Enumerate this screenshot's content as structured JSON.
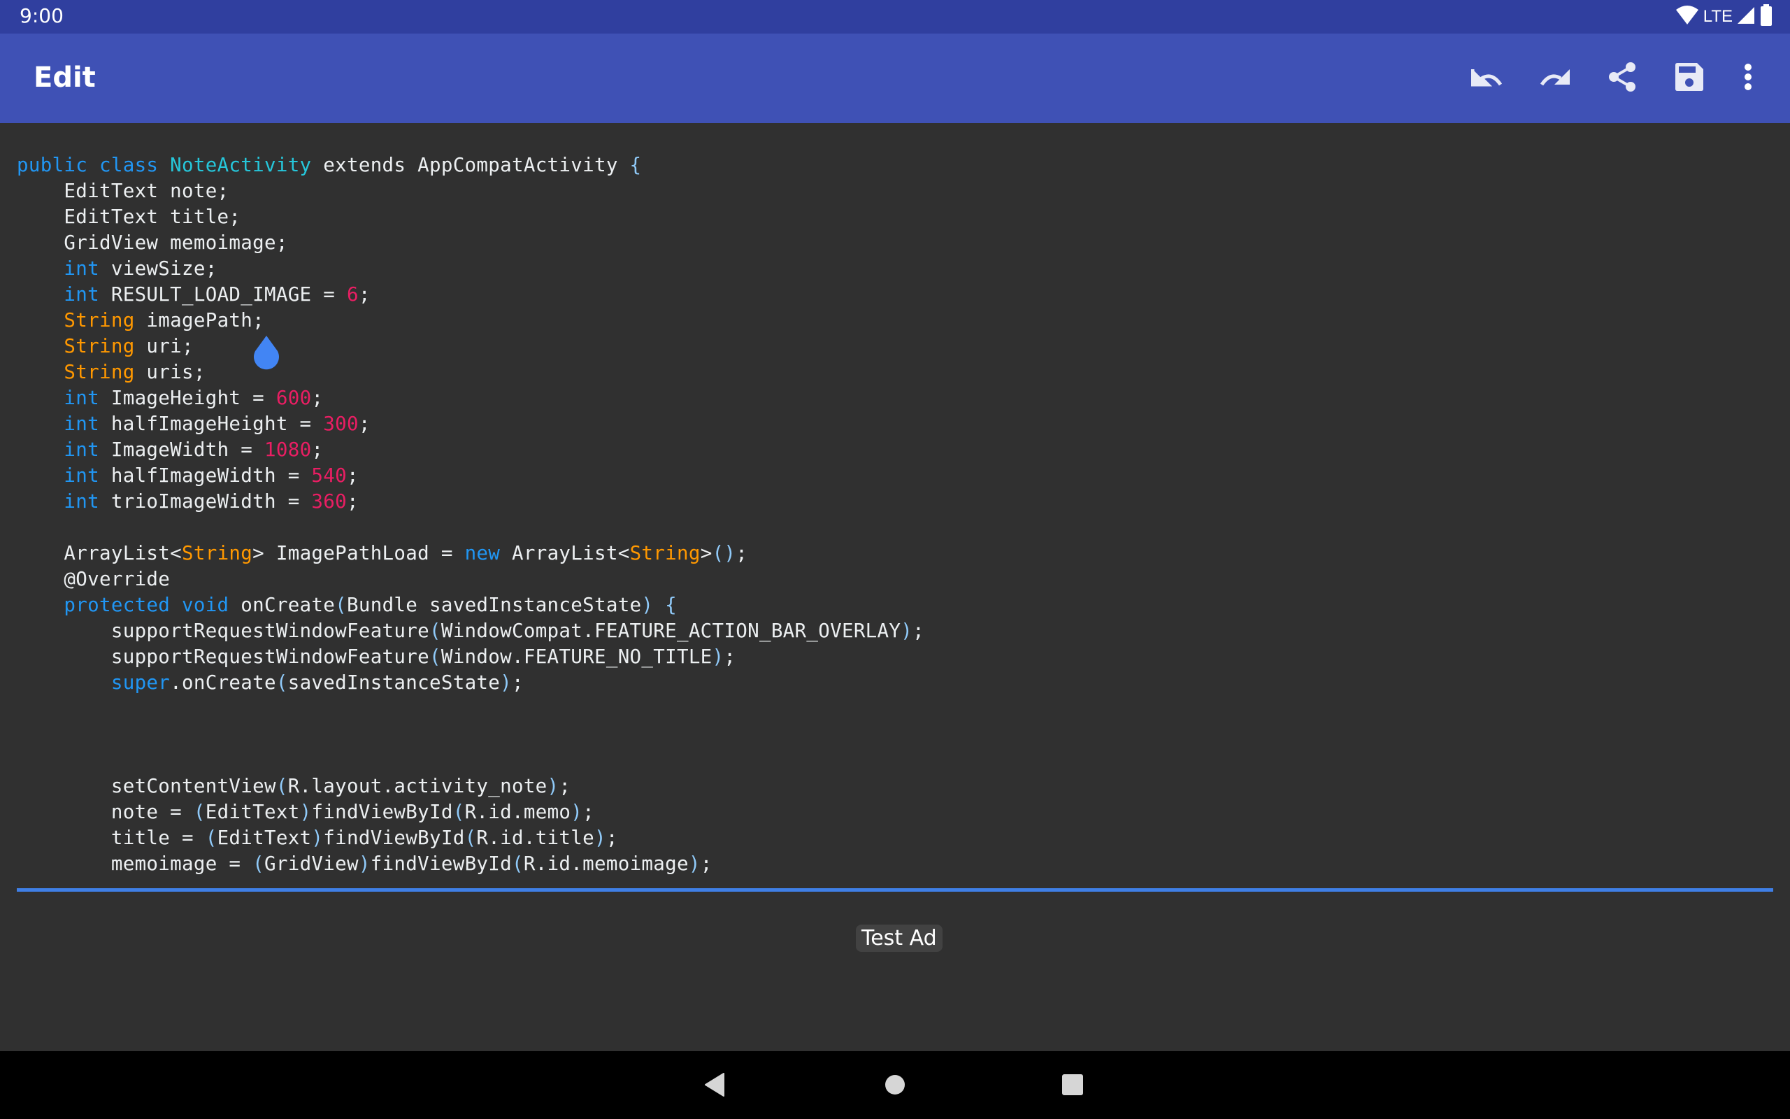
{
  "status_bar": {
    "time": "9:00",
    "network_label": "LTE",
    "icons": [
      "wifi-icon",
      "cell-signal-icon",
      "battery-icon"
    ]
  },
  "toolbar": {
    "title": "Edit",
    "actions": [
      {
        "name": "undo",
        "icon": "undo-icon"
      },
      {
        "name": "redo",
        "icon": "redo-icon"
      },
      {
        "name": "share",
        "icon": "share-icon"
      },
      {
        "name": "save",
        "icon": "save-icon"
      },
      {
        "name": "more",
        "icon": "more-vert-icon"
      }
    ]
  },
  "colors": {
    "status_bar": "#303F9F",
    "toolbar": "#3F51B5",
    "editor_bg": "#303030",
    "keyword": "#2196F3",
    "class_name": "#26C6DA",
    "type": "#FF9800",
    "number": "#E91E63",
    "paren": "#90CAF9",
    "text": "#ECEFF1",
    "accent": "#3F7FE6"
  },
  "editor": {
    "lines": [
      [
        [
          "kw",
          "public class "
        ],
        [
          "cls",
          "NoteActivity"
        ],
        [
          "plain",
          " extends AppCompatActivity "
        ],
        [
          "paren",
          "{"
        ]
      ],
      [
        [
          "plain",
          "    EditText note;"
        ]
      ],
      [
        [
          "plain",
          "    EditText title;"
        ]
      ],
      [
        [
          "plain",
          "    GridView memoimage;"
        ]
      ],
      [
        [
          "kw",
          "    int"
        ],
        [
          "plain",
          " viewSize;"
        ]
      ],
      [
        [
          "kw",
          "    int"
        ],
        [
          "plain",
          " RESULT_LOAD_IMAGE = "
        ],
        [
          "num",
          "6"
        ],
        [
          "plain",
          ";"
        ]
      ],
      [
        [
          "type",
          "    String"
        ],
        [
          "plain",
          " imagePath;"
        ]
      ],
      [
        [
          "type",
          "    String"
        ],
        [
          "plain",
          " uri;"
        ]
      ],
      [
        [
          "type",
          "    String"
        ],
        [
          "plain",
          " uris;"
        ]
      ],
      [
        [
          "kw",
          "    int"
        ],
        [
          "plain",
          " ImageHeight = "
        ],
        [
          "num",
          "600"
        ],
        [
          "plain",
          ";"
        ]
      ],
      [
        [
          "kw",
          "    int"
        ],
        [
          "plain",
          " halfImageHeight = "
        ],
        [
          "num",
          "300"
        ],
        [
          "plain",
          ";"
        ]
      ],
      [
        [
          "kw",
          "    int"
        ],
        [
          "plain",
          " ImageWidth = "
        ],
        [
          "num",
          "1080"
        ],
        [
          "plain",
          ";"
        ]
      ],
      [
        [
          "kw",
          "    int"
        ],
        [
          "plain",
          " halfImageWidth = "
        ],
        [
          "num",
          "540"
        ],
        [
          "plain",
          ";"
        ]
      ],
      [
        [
          "kw",
          "    int"
        ],
        [
          "plain",
          " trioImageWidth = "
        ],
        [
          "num",
          "360"
        ],
        [
          "plain",
          ";"
        ]
      ],
      [
        [
          "plain",
          ""
        ]
      ],
      [
        [
          "plain",
          "    ArrayList<"
        ],
        [
          "type",
          "String"
        ],
        [
          "plain",
          "> ImagePathLoad = "
        ],
        [
          "kw",
          "new"
        ],
        [
          "plain",
          " ArrayList<"
        ],
        [
          "type",
          "String"
        ],
        [
          "plain",
          ">"
        ],
        [
          "paren",
          "()"
        ],
        [
          "plain",
          ";"
        ]
      ],
      [
        [
          "plain",
          "    @Override"
        ]
      ],
      [
        [
          "kw",
          "    protected void"
        ],
        [
          "plain",
          " onCreate"
        ],
        [
          "paren",
          "("
        ],
        [
          "plain",
          "Bundle savedInstanceState"
        ],
        [
          "paren",
          ")"
        ],
        [
          "plain",
          " "
        ],
        [
          "paren",
          "{"
        ]
      ],
      [
        [
          "plain",
          "        supportRequestWindowFeature"
        ],
        [
          "paren",
          "("
        ],
        [
          "plain",
          "WindowCompat.FEATURE_ACTION_BAR_OVERLAY"
        ],
        [
          "paren",
          ")"
        ],
        [
          "plain",
          ";"
        ]
      ],
      [
        [
          "plain",
          "        supportRequestWindowFeature"
        ],
        [
          "paren",
          "("
        ],
        [
          "plain",
          "Window.FEATURE_NO_TITLE"
        ],
        [
          "paren",
          ")"
        ],
        [
          "plain",
          ";"
        ]
      ],
      [
        [
          "kw",
          "        super"
        ],
        [
          "plain",
          ".onCreate"
        ],
        [
          "paren",
          "("
        ],
        [
          "plain",
          "savedInstanceState"
        ],
        [
          "paren",
          ")"
        ],
        [
          "plain",
          ";"
        ]
      ],
      [
        [
          "plain",
          ""
        ]
      ],
      [
        [
          "plain",
          ""
        ]
      ],
      [
        [
          "plain",
          ""
        ]
      ],
      [
        [
          "plain",
          "        setContentView"
        ],
        [
          "paren",
          "("
        ],
        [
          "plain",
          "R.layout.activity_note"
        ],
        [
          "paren",
          ")"
        ],
        [
          "plain",
          ";"
        ]
      ],
      [
        [
          "plain",
          "        note = "
        ],
        [
          "paren",
          "("
        ],
        [
          "plain",
          "EditText"
        ],
        [
          "paren",
          ")"
        ],
        [
          "plain",
          "findViewById"
        ],
        [
          "paren",
          "("
        ],
        [
          "plain",
          "R.id.memo"
        ],
        [
          "paren",
          ")"
        ],
        [
          "plain",
          ";"
        ]
      ],
      [
        [
          "plain",
          "        title = "
        ],
        [
          "paren",
          "("
        ],
        [
          "plain",
          "EditText"
        ],
        [
          "paren",
          ")"
        ],
        [
          "plain",
          "findViewById"
        ],
        [
          "paren",
          "("
        ],
        [
          "plain",
          "R.id.title"
        ],
        [
          "paren",
          ")"
        ],
        [
          "plain",
          ";"
        ]
      ],
      [
        [
          "plain",
          "        memoimage = "
        ],
        [
          "paren",
          "("
        ],
        [
          "plain",
          "GridView"
        ],
        [
          "paren",
          ")"
        ],
        [
          "plain",
          "findViewById"
        ],
        [
          "paren",
          "("
        ],
        [
          "plain",
          "R.id.memoimage"
        ],
        [
          "paren",
          ")"
        ],
        [
          "plain",
          ";"
        ]
      ]
    ]
  },
  "ad": {
    "label": "Test Ad"
  },
  "nav_bar": {
    "buttons": [
      {
        "name": "back",
        "icon": "back-triangle-icon"
      },
      {
        "name": "home",
        "icon": "home-circle-icon"
      },
      {
        "name": "recents",
        "icon": "recents-square-icon"
      }
    ]
  }
}
